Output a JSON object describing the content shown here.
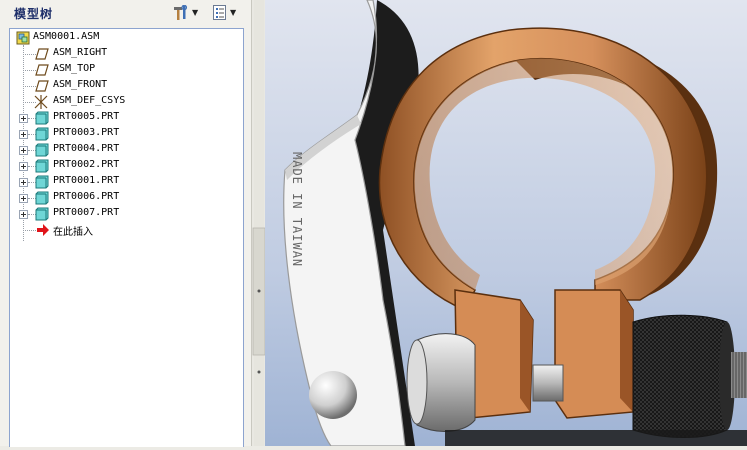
{
  "panel": {
    "title": "模型树",
    "buttons": [
      {
        "icon": "hammer-wrench-settings-icon",
        "dropdown": true
      },
      {
        "icon": "tree-list-options-icon",
        "dropdown": true
      }
    ]
  },
  "tree": {
    "root": {
      "label": "ASM0001.ASM",
      "icon": "assembly-icon"
    },
    "datums": [
      {
        "label": "ASM_RIGHT",
        "icon": "datum-plane-icon"
      },
      {
        "label": "ASM_TOP",
        "icon": "datum-plane-icon"
      },
      {
        "label": "ASM_FRONT",
        "icon": "datum-plane-icon"
      },
      {
        "label": "ASM_DEF_CSYS",
        "icon": "coordinate-system-icon"
      }
    ],
    "parts": [
      {
        "label": "PRT0005.PRT",
        "icon": "part-icon"
      },
      {
        "label": "PRT0003.PRT",
        "icon": "part-icon"
      },
      {
        "label": "PRT0004.PRT",
        "icon": "part-icon"
      },
      {
        "label": "PRT0002.PRT",
        "icon": "part-icon"
      },
      {
        "label": "PRT0001.PRT",
        "icon": "part-icon"
      },
      {
        "label": "PRT0006.PRT",
        "icon": "part-icon"
      },
      {
        "label": "PRT0007.PRT",
        "icon": "part-icon"
      }
    ],
    "insert_here": {
      "label": "在此插入",
      "icon": "insert-arrow-icon"
    }
  },
  "model": {
    "lever_engraving": "MADE IN TAIWAN",
    "colors": {
      "background_top": "#e1e5ef",
      "background_bottom": "#9fb3d4",
      "clamp": "#d6905c",
      "lever": "#f4f4f4",
      "knob": "#2a2a2a"
    }
  }
}
